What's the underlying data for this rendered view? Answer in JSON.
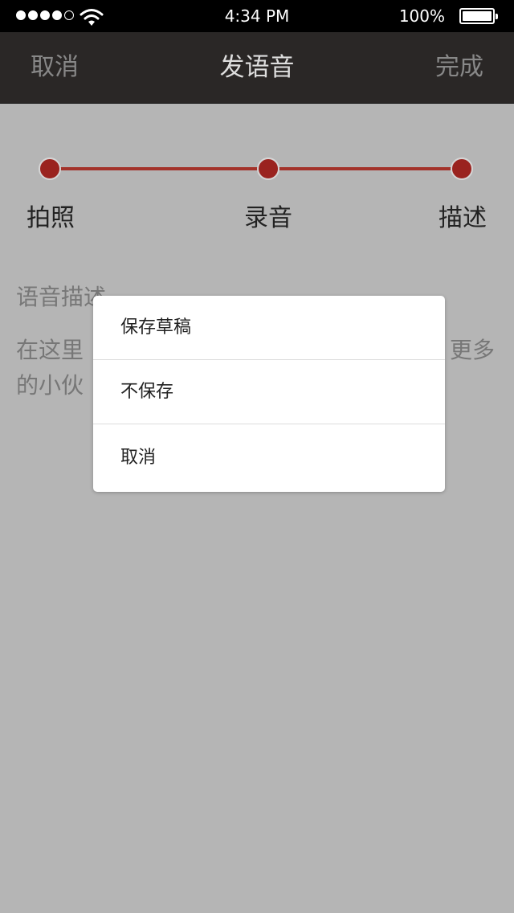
{
  "status_bar": {
    "time": "4:34 PM",
    "battery": "100%",
    "battery_level": 1.0,
    "signal_bars_filled": 4,
    "signal_bars_total": 5
  },
  "nav": {
    "left": "取消",
    "title": "发语音",
    "right": "完成"
  },
  "steps": [
    {
      "label": "拍照"
    },
    {
      "label": "录音"
    },
    {
      "label": "描述"
    }
  ],
  "description": {
    "title": "语音描述",
    "text": "在这里 更多 的小伙"
  },
  "dialog": {
    "items": [
      {
        "label": "保存草稿"
      },
      {
        "label": "不保存"
      },
      {
        "label": "取消"
      }
    ]
  },
  "colors": {
    "accent": "#9a231f",
    "nav_bg": "#2a2726",
    "overlay_bg": "#b5b5b5"
  }
}
